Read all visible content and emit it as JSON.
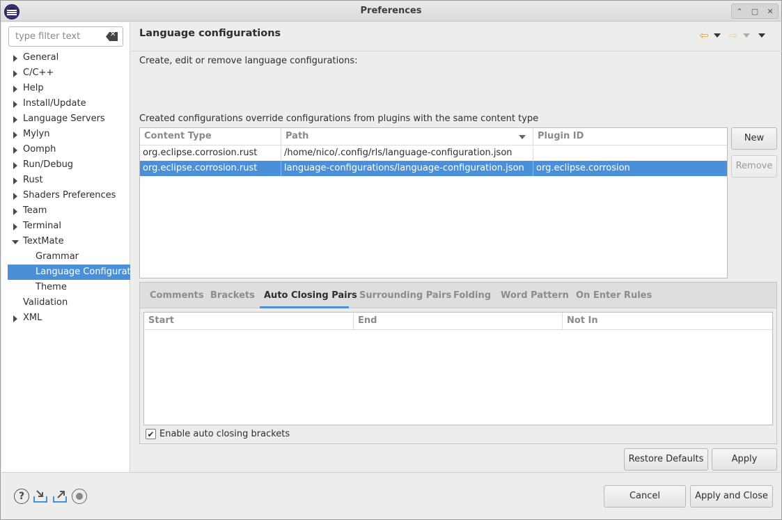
{
  "window": {
    "title": "Preferences"
  },
  "filter": {
    "placeholder": "type filter text"
  },
  "tree": {
    "items": [
      {
        "label": "General",
        "expandable": true
      },
      {
        "label": "C/C++",
        "expandable": true
      },
      {
        "label": "Help",
        "expandable": true
      },
      {
        "label": "Install/Update",
        "expandable": true
      },
      {
        "label": "Language Servers",
        "expandable": true
      },
      {
        "label": "Mylyn",
        "expandable": true
      },
      {
        "label": "Oomph",
        "expandable": true
      },
      {
        "label": "Run/Debug",
        "expandable": true
      },
      {
        "label": "Rust",
        "expandable": true
      },
      {
        "label": "Shaders Preferences",
        "expandable": true
      },
      {
        "label": "Team",
        "expandable": true
      },
      {
        "label": "Terminal",
        "expandable": true
      },
      {
        "label": "TextMate",
        "expandable": true,
        "expanded": true
      },
      {
        "label": "Grammar",
        "child": true
      },
      {
        "label": "Language Configurations",
        "child": true,
        "selected": true
      },
      {
        "label": "Theme",
        "child": true
      },
      {
        "label": "Validation",
        "expandable": false
      },
      {
        "label": "XML",
        "expandable": true
      }
    ]
  },
  "page": {
    "title": "Language configurations",
    "description": "Create, edit or remove language configurations:",
    "note": "Created configurations override configurations from plugins with the same content type"
  },
  "config_table": {
    "columns": [
      "Content Type",
      "Path",
      "Plugin ID"
    ],
    "rows": [
      {
        "content_type": "org.eclipse.corrosion.rust",
        "path": "/home/nico/.config/rls/language-configuration.json",
        "plugin_id": ""
      },
      {
        "content_type": "org.eclipse.corrosion.rust",
        "path": "language-configurations/language-configuration.json",
        "plugin_id": "org.eclipse.corrosion",
        "selected": true
      }
    ]
  },
  "buttons": {
    "new": "New",
    "remove": "Remove",
    "restore_defaults": "Restore Defaults",
    "apply": "Apply",
    "cancel": "Cancel",
    "apply_and_close": "Apply and Close"
  },
  "tabs": {
    "items": [
      "Comments",
      "Brackets",
      "Auto Closing Pairs",
      "Surrounding Pairs",
      "Folding",
      "Word Pattern",
      "On Enter Rules"
    ],
    "active": "Auto Closing Pairs"
  },
  "pairs_table": {
    "columns": [
      "Start",
      "End",
      "Not In"
    ]
  },
  "auto_close": {
    "label": "Enable auto closing brackets",
    "checked": true
  },
  "icons": {
    "help": "help-icon",
    "import": "import-icon",
    "export": "export-icon",
    "oomph": "oomph-icon",
    "back": "back-arrow-icon",
    "forward": "forward-arrow-icon",
    "menu": "view-menu-icon"
  },
  "colors": {
    "selection": "#4a90d9",
    "nav_arrow": "#e0a02a"
  }
}
